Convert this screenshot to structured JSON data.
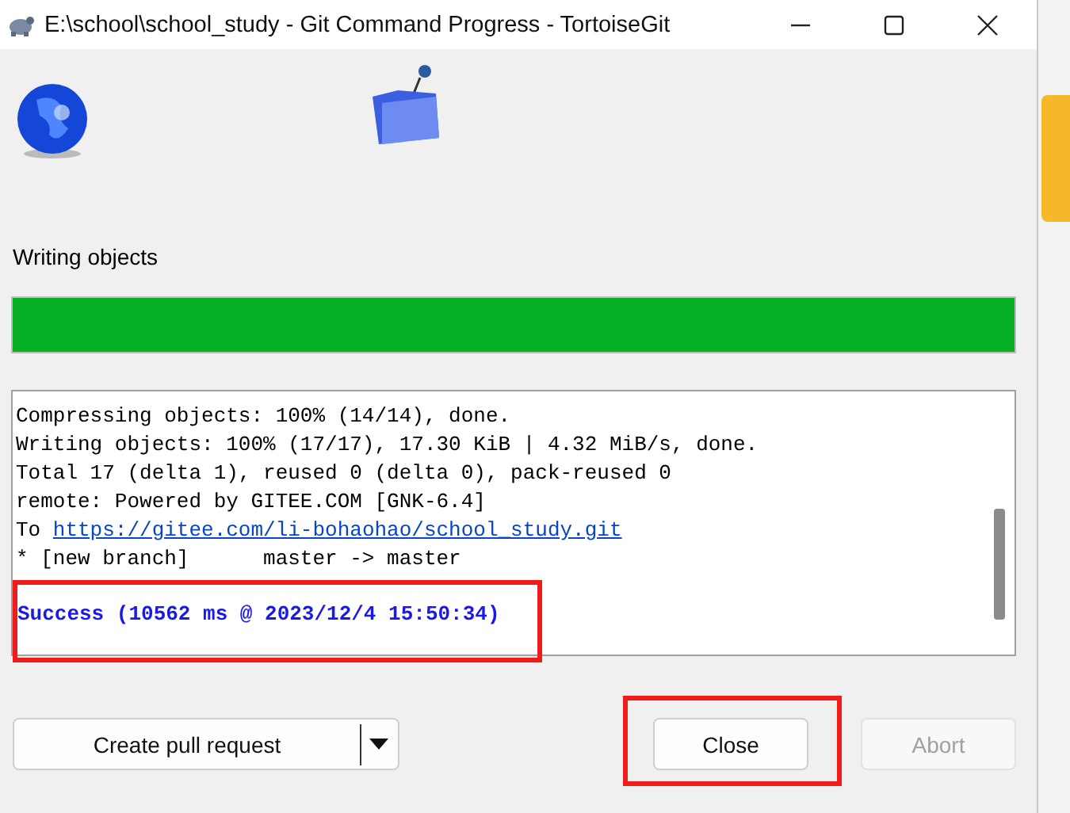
{
  "window": {
    "title": "E:\\school\\school_study - Git Command Progress - TortoiseGit"
  },
  "status_label": "Writing objects",
  "progress": {
    "level": 1.0
  },
  "log": {
    "lines": [
      {
        "kind": "text",
        "text": "Compressing objects: 100% (14/14), done."
      },
      {
        "kind": "text",
        "text": "Writing objects: 100% (17/17), 17.30 KiB | 4.32 MiB/s, done."
      },
      {
        "kind": "text",
        "text": "Total 17 (delta 1), reused 0 (delta 0), pack-reused 0"
      },
      {
        "kind": "text",
        "text": "remote: Powered by GITEE.COM [GNK-6.4]"
      },
      {
        "kind": "link",
        "prefix": "To ",
        "text": "https://gitee.com/li-bohaohao/school_study.git"
      },
      {
        "kind": "text",
        "text": "* [new branch]      master -> master"
      },
      {
        "kind": "success",
        "text": "Success (10562 ms @ 2023/12/4 15:50:34)"
      }
    ]
  },
  "buttons": [
    {
      "label": "Create pull request",
      "kind": "split",
      "disabled": false
    },
    {
      "label": "Close",
      "kind": "plain",
      "disabled": false
    },
    {
      "label": "Abort",
      "kind": "plain",
      "disabled": true
    }
  ]
}
